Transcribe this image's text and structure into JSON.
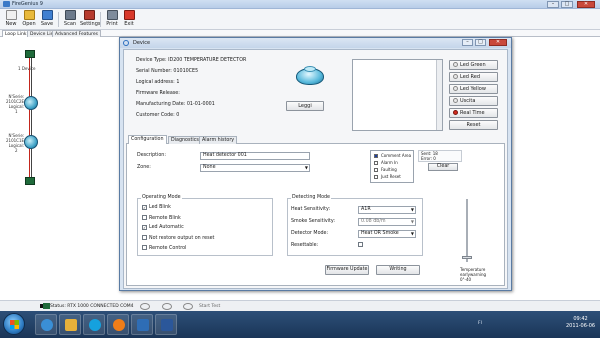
{
  "app": {
    "title": "FireGenius 9",
    "window_controls": [
      "–",
      "□",
      "✕"
    ]
  },
  "toolbar": {
    "items": [
      {
        "label": "New",
        "icon": "new-document-icon",
        "color": "#e8e8e8"
      },
      {
        "label": "Open",
        "icon": "open-folder-icon",
        "color": "#e8b93b"
      },
      {
        "label": "Save",
        "icon": "save-disk-icon",
        "color": "#3f7fd0"
      },
      {
        "label": "Scan",
        "icon": "scan-icon",
        "color": "#6c7a8c"
      },
      {
        "label": "Settings",
        "icon": "settings-tools-icon",
        "color": "#b63a2e"
      },
      {
        "label": "Print",
        "icon": "printer-icon",
        "color": "#7e8b9b"
      },
      {
        "label": "Exit",
        "icon": "exit-icon",
        "color": "#d8382b"
      }
    ]
  },
  "main_tabs": [
    "Loop Link",
    "Device List",
    "Advanced Features"
  ],
  "loop": {
    "node1": "1 Device",
    "node2": [
      "N'Serie:",
      "2101C2E8",
      "Logical:",
      "1"
    ],
    "node3": [
      "N'Serie:",
      "2101C1E8",
      "Logical:",
      "2"
    ]
  },
  "device_window": {
    "title": "Device",
    "controls": [
      "–",
      "□",
      "✕"
    ],
    "info": {
      "device_type": "Device Type: ID200 TEMPERATURE DETECTOR",
      "serial": "Serial Number: 01010CE5",
      "logical": "Logical address: 1",
      "firmware": "Firmware Release:",
      "mfg_date": "Manufacturing Date: 01-01-0001",
      "customer": "Customer Code: 0"
    },
    "leggi_button": "Leggi",
    "side_buttons": {
      "led_green": "Led Green",
      "led_red": "Led Red",
      "led_yellow": "Led Yellow",
      "uscita": "Uscita",
      "real_time": "Real Time",
      "reset": "Reset"
    },
    "tabs": [
      "Configuration",
      "Diagnostics",
      "Alarm history"
    ],
    "config": {
      "description_label": "Description:",
      "description_value": "Heat detector 001",
      "zone_label": "Zone:",
      "zone_value": "None",
      "legend": [
        "Comment Area",
        "Alarm In",
        "Faulting",
        "Just Reset"
      ],
      "legend_colors": [
        "#1d3fa0",
        "#ffffff",
        "#ffffff",
        "#ffffff"
      ],
      "meta": [
        "Sent: 18",
        "Error: 0"
      ],
      "clear_button": "Clear",
      "operating_mode": {
        "title": "Operating Mode",
        "options": [
          {
            "label": "Led Blink",
            "checked": true
          },
          {
            "label": "Remote Blink",
            "checked": false
          },
          {
            "label": "Led Automatic",
            "checked": true
          },
          {
            "label": "Not restore output on reset",
            "checked": false
          },
          {
            "label": "Remote Control",
            "checked": false
          }
        ]
      },
      "detecting_mode": {
        "title": "Detecting Mode",
        "heat_label": "Heat Sensitivity:",
        "heat_value": "A1R",
        "smoke_label": "Smoke Sensitivity:",
        "smoke_value": "0.08 db/m",
        "detector_label": "Detector Mode:",
        "detector_value": "Heat OR Smoke",
        "resettable_label": "Resettable:"
      },
      "temperature_label": [
        "Temperature",
        "earlywarning",
        "0°-40"
      ],
      "temperature_level": 0.05,
      "firmware_button": "Firmware Update",
      "writing_button": "Writing"
    }
  },
  "status": {
    "text": "Status: RTX 1000 CONNECTED COM4",
    "scan": "Start Test"
  },
  "taskbar": {
    "apps": [
      {
        "name": "ie-icon",
        "color": "#3a8fd6"
      },
      {
        "name": "explorer-icon",
        "color": "#e7b13a"
      },
      {
        "name": "skype-icon",
        "color": "#15a1de"
      },
      {
        "name": "media-player-icon",
        "color": "#ef7d18"
      },
      {
        "name": "firegenius-icon",
        "color": "#2e6db5"
      },
      {
        "name": "word-icon",
        "color": "#2b579a"
      }
    ],
    "tray": "FI",
    "time": "09:42",
    "date": "2011-06-06"
  }
}
